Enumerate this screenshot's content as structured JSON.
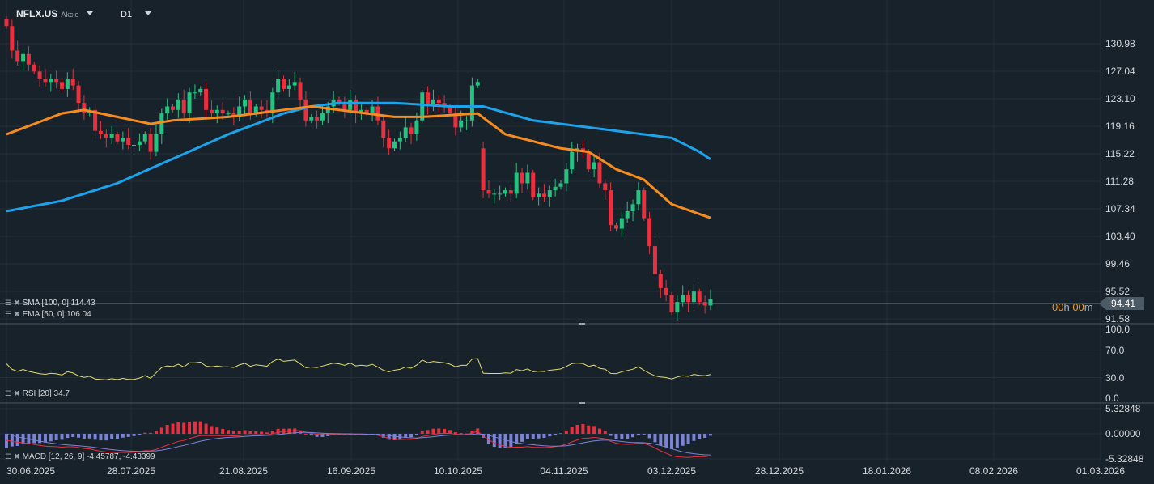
{
  "header": {
    "symbol": "NFLX.US",
    "asset_type": "Akcie",
    "timeframe": "D1"
  },
  "price_axis": [
    "130.98",
    "127.04",
    "123.10",
    "119.16",
    "115.22",
    "111.28",
    "107.34",
    "103.40",
    "99.46",
    "95.52",
    "91.58"
  ],
  "last_price": "94.41",
  "countdown": {
    "hours": "00",
    "h": "h",
    "minutes": "00",
    "m": "m"
  },
  "rsi_axis": [
    "100.0",
    "70.0",
    "30.0",
    "0.0"
  ],
  "macd_axis": [
    "5.32848",
    "0.00000",
    "-5.32848"
  ],
  "dates": [
    "30.06.2025",
    "28.07.2025",
    "21.08.2025",
    "16.09.2025",
    "10.10.2025",
    "04.11.2025",
    "03.12.2025",
    "28.12.2025",
    "18.01.2026",
    "08.02.2026",
    "01.03.2026"
  ],
  "indicators": {
    "sma": "SMA [100, 0] 114.43",
    "ema": "EMA [50, 0] 106.04",
    "rsi": "RSI [20] 34.7",
    "macd": "MACD [12, 26, 9] -4.45787, -4.43399"
  },
  "colors": {
    "up": "#26c281",
    "down": "#e8303f",
    "sma": "#1ca3ec",
    "ema": "#f68c1f",
    "rsi": "#e3dc6a",
    "macd": "#e8303f",
    "signal": "#7b83d6",
    "hist_pos": "#e8303f",
    "hist_neg": "#7b83d6"
  },
  "chart_data": {
    "type": "candlestick",
    "closes": [
      133.5,
      130,
      128.5,
      129.5,
      128,
      127,
      126,
      125.5,
      126,
      125.5,
      124.5,
      126,
      125,
      122.5,
      121,
      121.5,
      118.5,
      118,
      117.5,
      118,
      117,
      117.5,
      116.5,
      116.5,
      117,
      118,
      115.5,
      118,
      121,
      122,
      121.5,
      123,
      121,
      124,
      124,
      124.5,
      121.5,
      121,
      121.5,
      121,
      121,
      120.5,
      122,
      123,
      121,
      122,
      121.5,
      121,
      124,
      126,
      124.5,
      125,
      125.5,
      123,
      120,
      120.5,
      120,
      121,
      122,
      123,
      122.5,
      121.5,
      123,
      121,
      121.5,
      121,
      122,
      120,
      117.5,
      116,
      117,
      117.5,
      119,
      118,
      120,
      124,
      122,
      123,
      122.5,
      122,
      121,
      119,
      120,
      120,
      125,
      125.5,
      110,
      109.5,
      109.5,
      109.5,
      110,
      109.5,
      112.5,
      111,
      112.5,
      109,
      109.5,
      109,
      110,
      110.5,
      111,
      113,
      115.5,
      116,
      115.5,
      113,
      114,
      111,
      110,
      105,
      104.5,
      106,
      107,
      108,
      110,
      106,
      102,
      98,
      96,
      95,
      92.5,
      94,
      95,
      94,
      95.5,
      94,
      93.5,
      94.41
    ],
    "gap_opens": {
      "86": 116
    },
    "sma_points": [
      [
        0,
        107
      ],
      [
        10,
        108.5
      ],
      [
        20,
        111
      ],
      [
        30,
        114.5
      ],
      [
        40,
        118
      ],
      [
        50,
        121
      ],
      [
        55,
        122
      ],
      [
        60,
        122.5
      ],
      [
        70,
        122.5
      ],
      [
        80,
        122
      ],
      [
        86,
        122
      ],
      [
        95,
        120
      ],
      [
        105,
        119
      ],
      [
        115,
        118
      ],
      [
        120,
        117.5
      ],
      [
        125,
        115.5
      ],
      [
        127,
        114.43
      ]
    ],
    "ema_points": [
      [
        0,
        118
      ],
      [
        10,
        121
      ],
      [
        14,
        121.5
      ],
      [
        20,
        120.5
      ],
      [
        26,
        119.5
      ],
      [
        30,
        120
      ],
      [
        40,
        120.5
      ],
      [
        50,
        121.5
      ],
      [
        55,
        122
      ],
      [
        60,
        121.5
      ],
      [
        70,
        120.5
      ],
      [
        75,
        120.5
      ],
      [
        85,
        121
      ],
      [
        90,
        118
      ],
      [
        100,
        116
      ],
      [
        105,
        115.5
      ],
      [
        110,
        113
      ],
      [
        115,
        111.5
      ],
      [
        120,
        108
      ],
      [
        127,
        106.04
      ]
    ],
    "ylim": [
      91.58,
      130.98
    ]
  }
}
